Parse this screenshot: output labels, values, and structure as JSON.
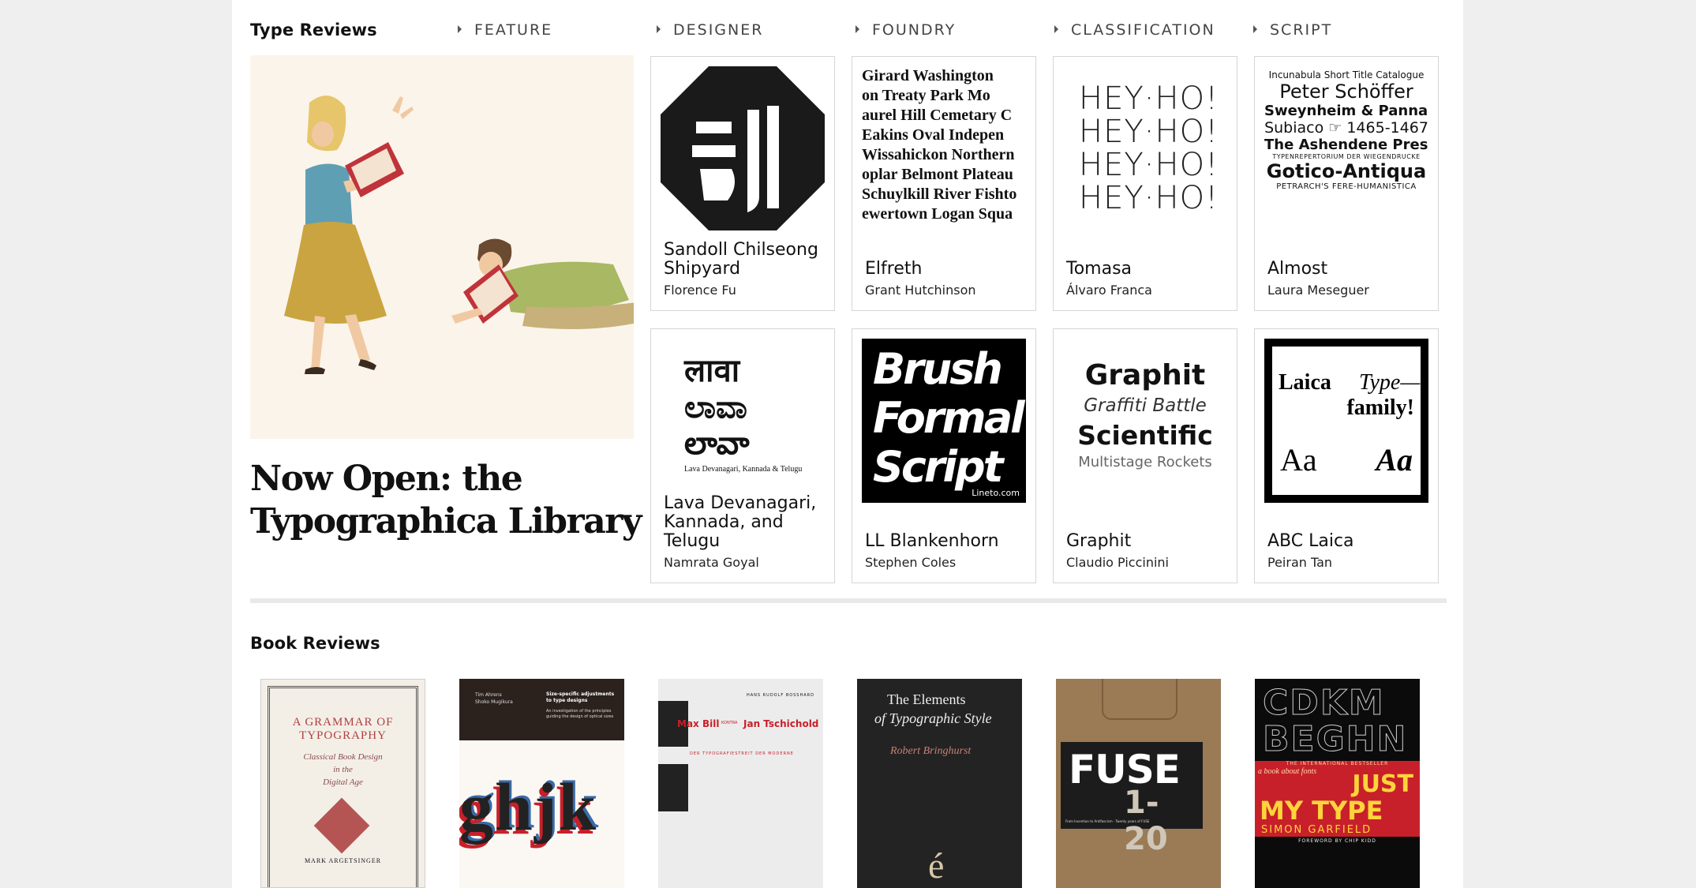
{
  "type_reviews": {
    "title": "Type Reviews",
    "nav": [
      {
        "label": "FEATURE"
      },
      {
        "label": "DESIGNER"
      },
      {
        "label": "FOUNDRY"
      },
      {
        "label": "CLASSIFICATION"
      },
      {
        "label": "SCRIPT"
      }
    ],
    "hero": {
      "title_line1": "Now Open: the",
      "title_line2": "Typographica Library"
    },
    "cards": [
      {
        "name": "Sandoll Chilseong Shipyard",
        "author": "Florence Fu"
      },
      {
        "name": "Elfreth",
        "author": "Grant Hutchinson",
        "specimen_lines": [
          "Girard Washington",
          "on Treaty Park Mo",
          "aurel Hill Cemetary C",
          "Eakins Oval Indepen",
          "Wissahickon Northern",
          "oplar Belmont Plateau",
          "Schuylkill River Fishto",
          "ewertown Logan Squa"
        ]
      },
      {
        "name": "Tomasa",
        "author": "Álvaro Franca",
        "specimen_lines": [
          "HEY·HO!",
          "HEY·HO!",
          "HEY·HO!",
          "HEY·HO!"
        ]
      },
      {
        "name": "Almost",
        "author": "Laura Meseguer",
        "specimen_lines": [
          "Incunabula Short Title Catalogue",
          "Peter Schöffer",
          "Sweynheim & Pannartz",
          "Subiaco ☞ 1465-1467",
          "The Ashendene Press",
          "TYPENREPERTORIUM DER WIEGENDRUCKE",
          "Gotico-Antiqua",
          "PETRARCH'S FERE-HUMANISTICA"
        ]
      },
      {
        "name": "Lava Devanagari, Kannada, and Telugu",
        "author": "Namrata Goyal",
        "specimen_lines": [
          "लावा",
          "ಲಾವಾ",
          "లావా",
          "Lava Devanagari, Kannada & Telugu"
        ]
      },
      {
        "name": "LL Blankenhorn",
        "author": "Stephen Coles",
        "specimen_lines": [
          "Brush",
          "Formal",
          "Script",
          "Lineto.com"
        ]
      },
      {
        "name": "Graphit",
        "author": "Claudio Piccinini",
        "specimen_lines": [
          "Graphit",
          "Graffiti Battle",
          "Scientific",
          "Multistage Rockets"
        ]
      },
      {
        "name": "ABC Laica",
        "author": "Peiran Tan",
        "specimen_lines": [
          "Laica",
          "Type—",
          "family!",
          "Aa",
          "Aa"
        ]
      }
    ]
  },
  "book_reviews": {
    "title": "Book Reviews",
    "books": [
      {
        "lines": [
          "A GRAMMAR OF",
          "TYPOGRAPHY",
          "Classical Book Design",
          "in the",
          "Digital Age",
          "MARK ARGETSINGER"
        ]
      },
      {
        "lines": [
          "Tim Ahrens",
          "Shoko Mugikura",
          "Size-specific adjustments to type designs",
          "An investigation of the principles guiding the design of optical sizes",
          "ghjk"
        ]
      },
      {
        "lines": [
          "HANS RUDOLF BOSSHARD",
          "Max Bill",
          "KONTRA",
          "Jan Tschichold",
          "DER TYPOGRAFIESTREIT DER MODERNE"
        ]
      },
      {
        "lines": [
          "The Elements",
          "of Typographic Style",
          "Robert Bringhurst"
        ]
      },
      {
        "lines": [
          "FUSE",
          "1-20",
          "From Invention to Antifascism · Twenty years of FUSE"
        ]
      },
      {
        "lines": [
          "THE INTERNATIONAL BESTSELLER",
          "a book about fonts",
          "JUST",
          "MY TYPE",
          "SIMON GARFIELD",
          "FOREWORD BY CHIP KIDD"
        ]
      }
    ]
  },
  "colors": {
    "accent_red": "#c8202a",
    "hero_bg": "#fbf4ea",
    "card_border": "#d6d6d6"
  }
}
